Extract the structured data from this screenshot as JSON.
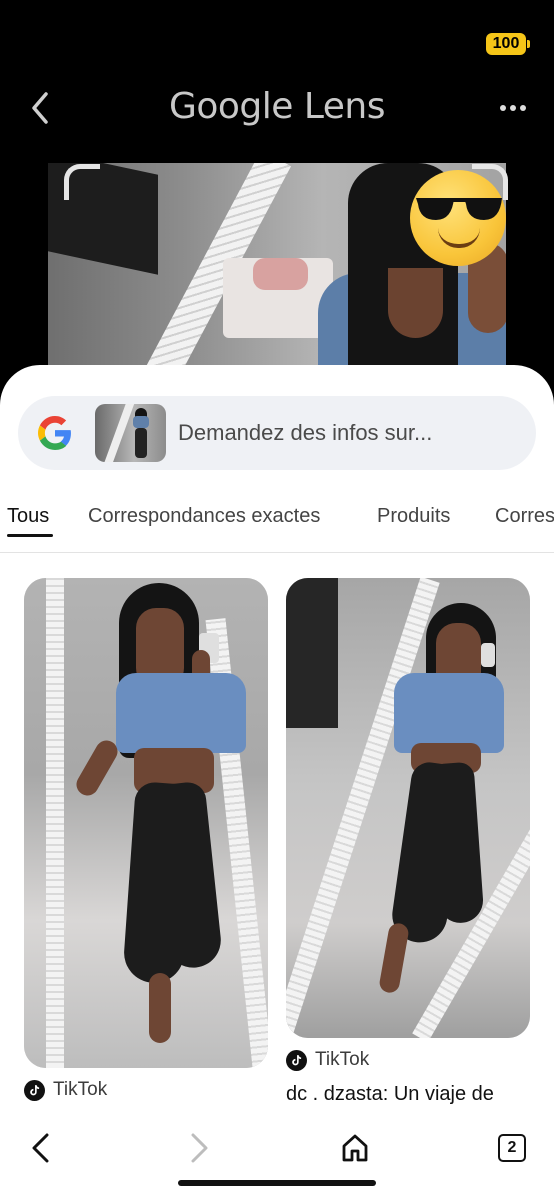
{
  "status": {
    "battery": "100"
  },
  "header": {
    "title": "Google Lens"
  },
  "search": {
    "placeholder": "Demandez des infos sur..."
  },
  "tabs": [
    {
      "label": "Tous",
      "active": true
    },
    {
      "label": "Correspondances exactes",
      "active": false
    },
    {
      "label": "Produits",
      "active": false
    },
    {
      "label": "Corres",
      "active": false
    }
  ],
  "results": [
    {
      "source": "TikTok",
      "title": ""
    },
    {
      "source": "TikTok",
      "title": "dc . dzasta: Un viaje de"
    }
  ],
  "bottom_nav": {
    "tab_count": "2"
  },
  "colors": {
    "battery": "#f5c518",
    "sheet": "#ffffff",
    "pill": "#eff1f5",
    "top_bg": "#000000"
  }
}
